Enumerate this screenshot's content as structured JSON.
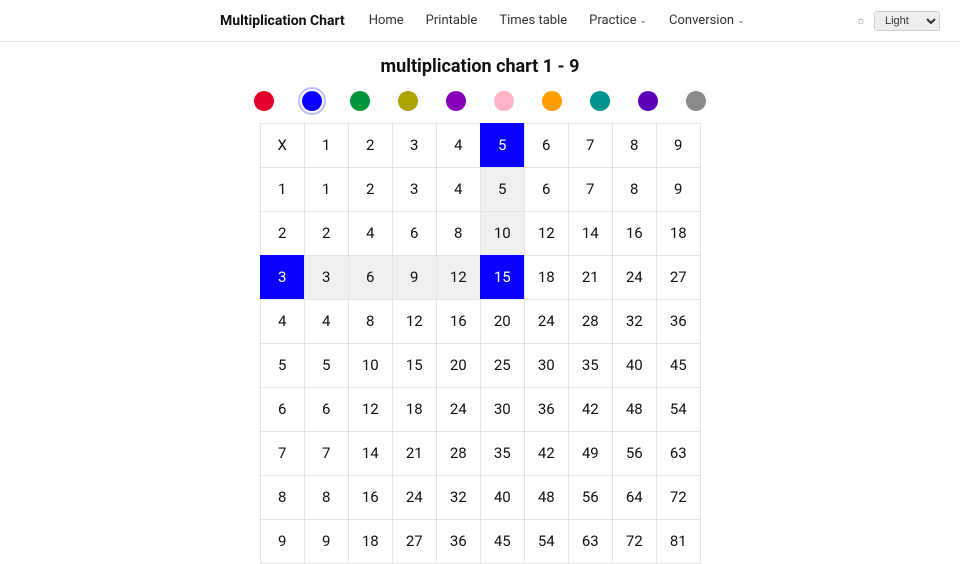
{
  "header": {
    "brand": "Multiplication Chart",
    "nav": [
      {
        "label": "Home",
        "dropdown": false
      },
      {
        "label": "Printable",
        "dropdown": false
      },
      {
        "label": "Times table",
        "dropdown": false
      },
      {
        "label": "Practice",
        "dropdown": true
      },
      {
        "label": "Conversion",
        "dropdown": true
      }
    ],
    "theme_selected": "Light"
  },
  "title": "multiplication chart 1 - 9",
  "swatches": {
    "colors": [
      "#e4002b",
      "#0a00ff",
      "#009639",
      "#aaa300",
      "#8a00b8",
      "#ffb3c7",
      "#ff9e00",
      "#009490",
      "#5c00b8",
      "#8a8a8a"
    ],
    "selected_index": 1
  },
  "chart_data": {
    "type": "table",
    "title": "multiplication chart 1 - 9",
    "size": 9,
    "corner_label": "X",
    "row_headers": [
      1,
      2,
      3,
      4,
      5,
      6,
      7,
      8,
      9
    ],
    "col_headers": [
      1,
      2,
      3,
      4,
      5,
      6,
      7,
      8,
      9
    ],
    "values": [
      [
        1,
        2,
        3,
        4,
        5,
        6,
        7,
        8,
        9
      ],
      [
        2,
        4,
        6,
        8,
        10,
        12,
        14,
        16,
        18
      ],
      [
        3,
        6,
        9,
        12,
        15,
        18,
        21,
        24,
        27
      ],
      [
        4,
        8,
        12,
        16,
        20,
        24,
        28,
        32,
        36
      ],
      [
        5,
        10,
        15,
        20,
        25,
        30,
        35,
        40,
        45
      ],
      [
        6,
        12,
        18,
        24,
        30,
        36,
        42,
        48,
        54
      ],
      [
        7,
        14,
        21,
        28,
        35,
        42,
        49,
        56,
        63
      ],
      [
        8,
        16,
        24,
        32,
        40,
        48,
        56,
        64,
        72
      ],
      [
        9,
        18,
        27,
        36,
        45,
        54,
        63,
        72,
        81
      ]
    ],
    "highlight": {
      "row": 3,
      "col": 5
    }
  }
}
